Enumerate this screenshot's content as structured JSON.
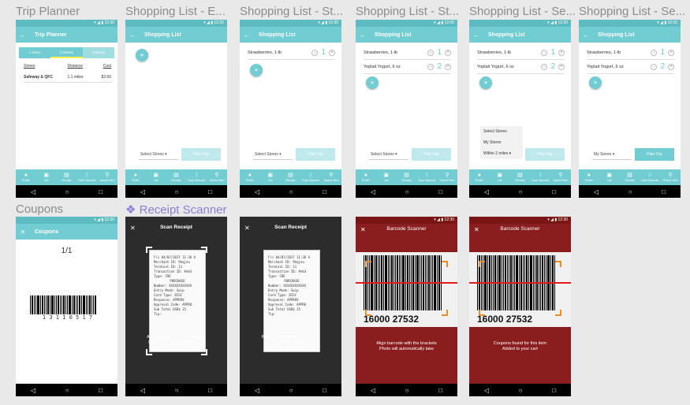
{
  "labels": {
    "trip_planner": "Trip Planner",
    "shopping_list_e": "Shopping List - E...",
    "shopping_list_st1": "Shopping List - St...",
    "shopping_list_st2": "Shopping List - St...",
    "shopping_list_se1": "Shopping List - Se...",
    "shopping_list_se2": "Shopping List - Se...",
    "coupons": "Coupons",
    "receipt_scanner": "❖ Receipt Scanner"
  },
  "status_time": "▾ ◢ ▮ 12:30",
  "trip": {
    "title": "Trip Planner",
    "tabs": [
      "1 Store",
      "2 Stores",
      "3 Stores"
    ],
    "headers": [
      "Stores",
      "Distance",
      "Cost"
    ],
    "row": [
      "Safeway & QFC",
      "1.1 miles",
      "$3.50"
    ]
  },
  "list_title": "Shopping List",
  "items": [
    {
      "name": "Strawberries, 1-lb",
      "qty": "1"
    },
    {
      "name": "Yoplait Yogurt, 6 oz",
      "qty": "2"
    }
  ],
  "select_stores": "Select Stores",
  "plan_trip": "Plan Trip",
  "my_stores": "My Stores",
  "dropdown": [
    "Select Stores",
    "My Stores",
    "Within 2 miles"
  ],
  "nav": [
    "Profile",
    "List",
    "Receipt",
    "Scan Barcode",
    "Search Item"
  ],
  "coupons": {
    "title": "Coupons",
    "page": "1/1",
    "barcode_num": "1 3 1 1 0 5 1 7"
  },
  "receipt": {
    "title": "Scan Receipt",
    "lines": [
      "Fri 04/07/2017 11:36 A",
      "Merchant ID:  9hqjeu",
      "Terminal ID:      11",
      "Transaction ID: #eb3",
      "Type:            CRE",
      "PURCHASE",
      "Number: XXXXXXXXXXXX",
      "Entry Mode:     Swip",
      "Card Type:      DISC",
      "Response:     APPROV",
      "Approval Code: APPRO",
      "Sub Total    USD$ 25",
      "Tip:"
    ],
    "align_text": [
      "Align receipt with the brackets.",
      "Photo will automatically take."
    ],
    "success_text": [
      "Receipt successfully scanned!",
      "Thank you!"
    ]
  },
  "barcode": {
    "title": "Barcode Scanner",
    "number": "16000 27532",
    "align_text": [
      "Align barcode with the brackets",
      "Photo will automatically take"
    ],
    "found_text": [
      "Coupons found for this item",
      "Added to your cart"
    ]
  }
}
